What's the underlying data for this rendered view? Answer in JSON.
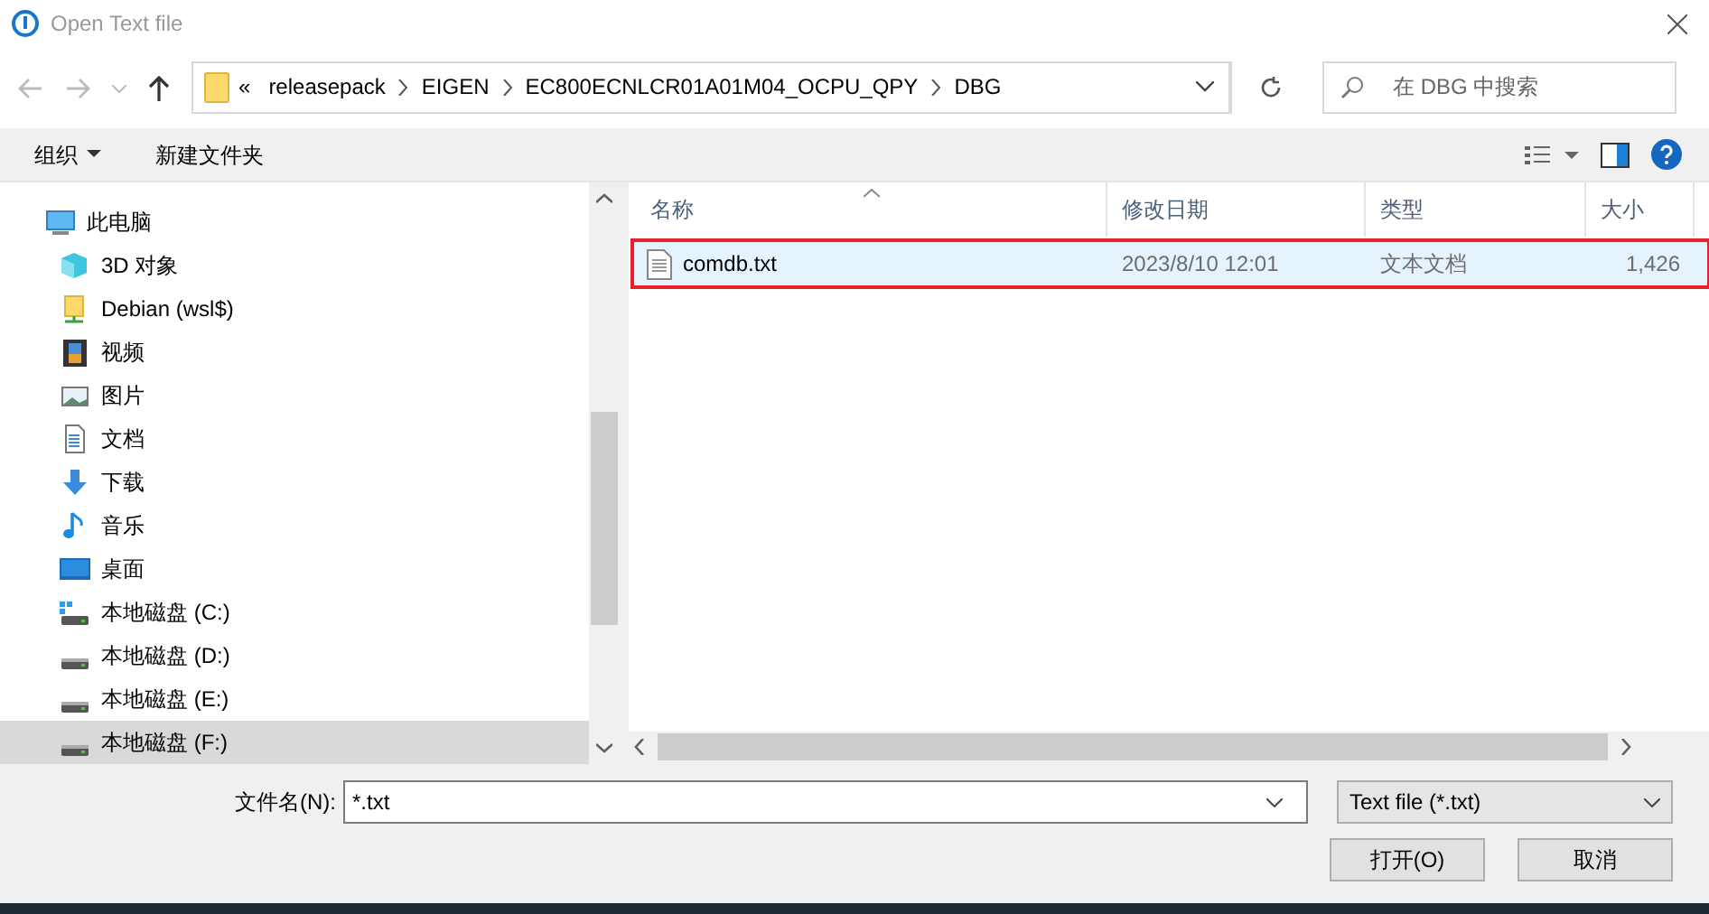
{
  "window": {
    "title": "Open Text file"
  },
  "address_bar": {
    "path": [
      "«",
      "releasepack",
      "EIGEN",
      "EC800ECNLCR01A01M04_OCPU_QPY",
      "DBG"
    ],
    "search_placeholder": "在 DBG 中搜索"
  },
  "toolbar": {
    "organize": "组织",
    "new_folder": "新建文件夹"
  },
  "sidebar": {
    "items": [
      {
        "label": "此电脑",
        "kind": "computer",
        "selected": false,
        "children": [
          {
            "label": "3D 对象",
            "kind": "cube",
            "selected": false
          },
          {
            "label": "Debian (wsl$)",
            "kind": "netfolder",
            "selected": false
          },
          {
            "label": "视频",
            "kind": "video",
            "selected": false
          },
          {
            "label": "图片",
            "kind": "picture",
            "selected": false
          },
          {
            "label": "文档",
            "kind": "document",
            "selected": false
          },
          {
            "label": "下载",
            "kind": "download",
            "selected": false
          },
          {
            "label": "音乐",
            "kind": "music",
            "selected": false
          },
          {
            "label": "桌面",
            "kind": "desktop",
            "selected": false
          },
          {
            "label": "本地磁盘 (C:)",
            "kind": "sysdrive",
            "selected": false
          },
          {
            "label": "本地磁盘 (D:)",
            "kind": "drive",
            "selected": false
          },
          {
            "label": "本地磁盘 (E:)",
            "kind": "drive",
            "selected": false
          },
          {
            "label": "本地磁盘 (F:)",
            "kind": "drive",
            "selected": true
          }
        ]
      }
    ]
  },
  "file_list": {
    "columns": [
      "名称",
      "修改日期",
      "类型",
      "大小"
    ],
    "rows": [
      {
        "name": "comdb.txt",
        "date": "2023/8/10 12:01",
        "type": "文本文档",
        "size": "1,426",
        "selected": true,
        "highlighted": true
      }
    ]
  },
  "filename": {
    "label": "文件名(N):",
    "value": "*.txt"
  },
  "filetype": {
    "value": "Text file (*.txt)"
  },
  "buttons": [
    "打开(O)",
    "取消"
  ]
}
